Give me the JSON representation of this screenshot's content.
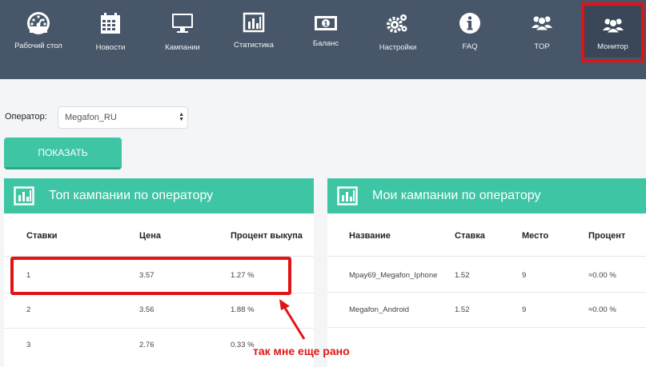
{
  "nav": {
    "items": [
      {
        "label": "Рабочий стол",
        "icon": "dashboard-gauge-icon"
      },
      {
        "label": "Новости",
        "icon": "calendar-icon"
      },
      {
        "label": "Кампании",
        "icon": "monitor-icon"
      },
      {
        "label": "Статистика",
        "icon": "bar-chart-icon"
      },
      {
        "label": "Баланс",
        "icon": "money-icon"
      },
      {
        "label": "Настройки",
        "icon": "gears-icon"
      },
      {
        "label": "FAQ",
        "icon": "info-icon"
      },
      {
        "label": "TOP",
        "icon": "users-icon"
      },
      {
        "label": "Монитор",
        "icon": "users-icon"
      }
    ],
    "active": "Монитор"
  },
  "operator": {
    "label": "Оператор:",
    "selected": "Megafon_RU"
  },
  "show_button": "ПОКАЗАТЬ",
  "top_panel": {
    "title": "Топ кампании по оператору",
    "columns": [
      "Ставки",
      "Цена",
      "Процент выкупа"
    ],
    "rows": [
      [
        "1",
        "3.57",
        "1.27 %"
      ],
      [
        "2",
        "3.56",
        "1.88 %"
      ],
      [
        "3",
        "2.76",
        "0.33 %"
      ]
    ]
  },
  "my_panel": {
    "title": "Мои кампании по оператору",
    "columns": [
      "Название",
      "Ставка",
      "Место",
      "Процент"
    ],
    "rows": [
      [
        "Mpay69_Megafon_Iphone",
        "1.52",
        "9",
        "≈0.00 %"
      ],
      [
        "Megafon_Android",
        "1.52",
        "9",
        "≈0.00 %"
      ]
    ]
  },
  "annotation": {
    "note": "так мне еще рано"
  },
  "colors": {
    "nav_bg": "#475669",
    "accent": "#3ec5a3",
    "highlight": "#e01414"
  }
}
